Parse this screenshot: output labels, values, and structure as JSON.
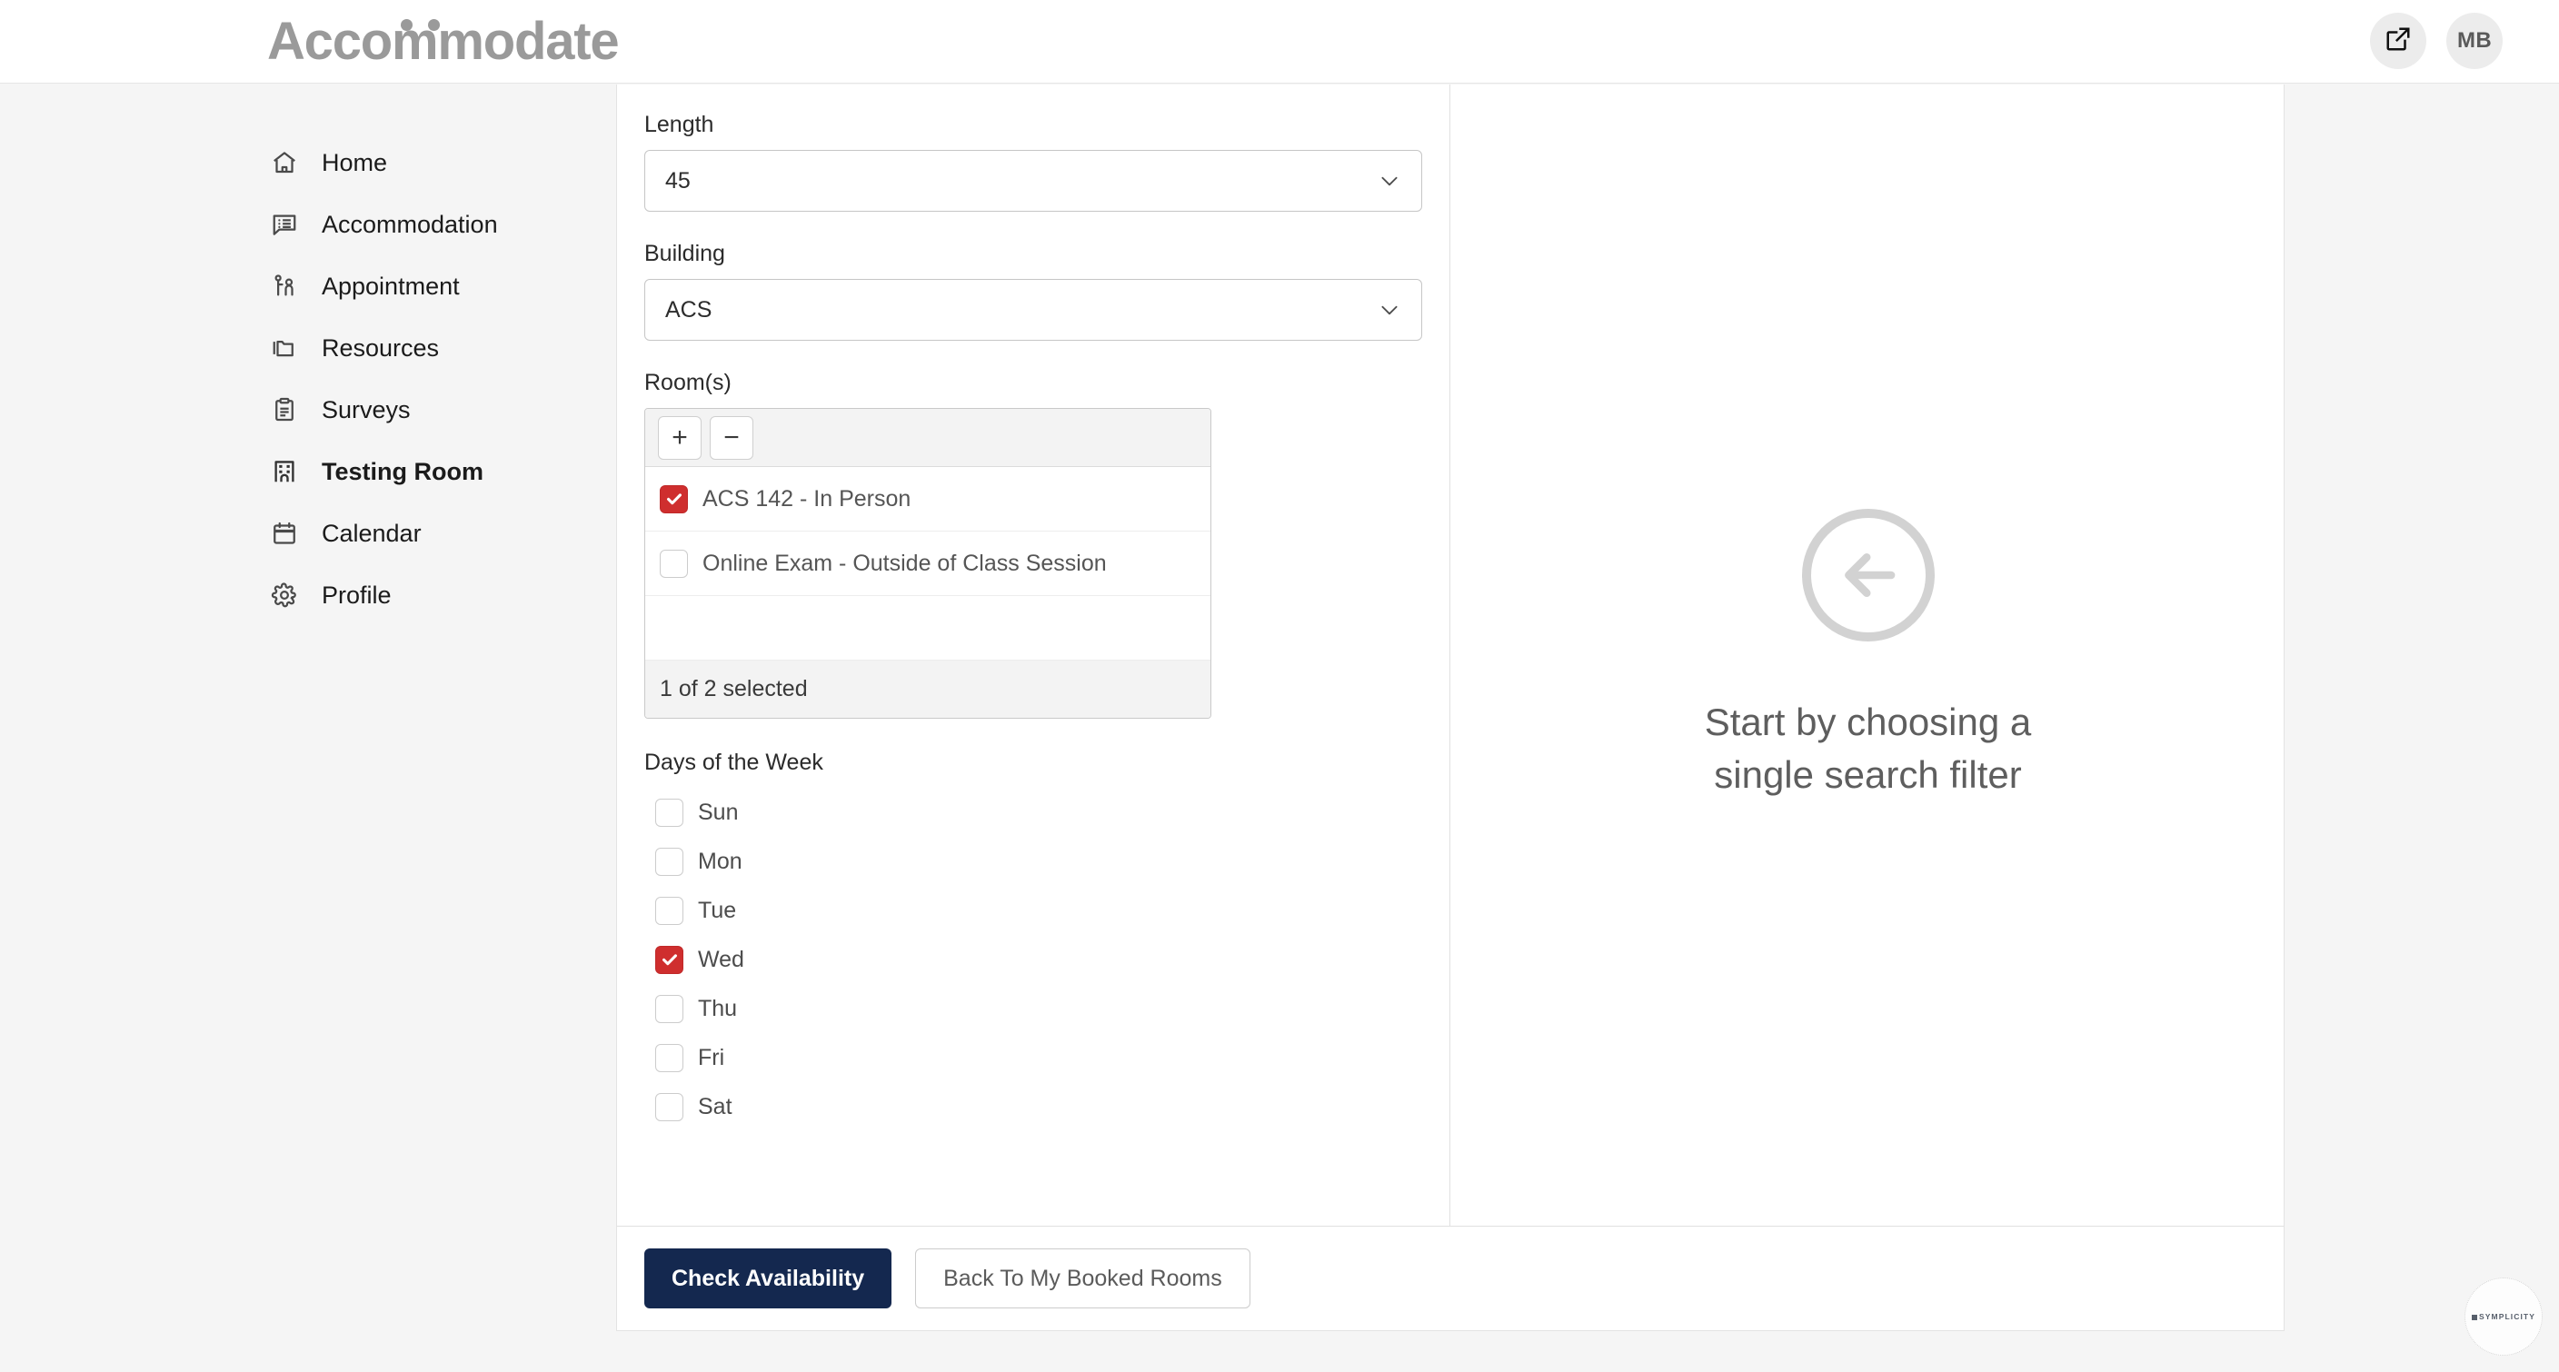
{
  "header": {
    "brand": "Accommodate",
    "brand_part_1": "Acco",
    "brand_part_2": "mm",
    "brand_part_3": "odate",
    "external_link_title": "Open in new window",
    "avatar_initials": "MB"
  },
  "sidebar": {
    "items": [
      {
        "label": "Home",
        "icon": "home-icon",
        "active": false
      },
      {
        "label": "Accommodation",
        "icon": "chat-list-icon",
        "active": false
      },
      {
        "label": "Appointment",
        "icon": "people-icon",
        "active": false
      },
      {
        "label": "Resources",
        "icon": "folders-icon",
        "active": false
      },
      {
        "label": "Surveys",
        "icon": "clipboard-icon",
        "active": false
      },
      {
        "label": "Testing Room",
        "icon": "building-icon",
        "active": true
      },
      {
        "label": "Calendar",
        "icon": "calendar-icon",
        "active": false
      },
      {
        "label": "Profile",
        "icon": "gear-icon",
        "active": false
      }
    ]
  },
  "form": {
    "length": {
      "label": "Length",
      "value": "45"
    },
    "building": {
      "label": "Building",
      "value": "ACS"
    },
    "rooms": {
      "label": "Room(s)",
      "add_button": "+",
      "remove_button": "−",
      "options": [
        {
          "label": "ACS 142 - In Person",
          "checked": true
        },
        {
          "label": "Online Exam - Outside of Class Session",
          "checked": false
        }
      ],
      "selection_summary": "1 of 2 selected"
    },
    "days": {
      "label": "Days of the Week",
      "options": [
        {
          "label": "Sun",
          "checked": false
        },
        {
          "label": "Mon",
          "checked": false
        },
        {
          "label": "Tue",
          "checked": false
        },
        {
          "label": "Wed",
          "checked": true
        },
        {
          "label": "Thu",
          "checked": false
        },
        {
          "label": "Fri",
          "checked": false
        },
        {
          "label": "Sat",
          "checked": false
        }
      ]
    }
  },
  "preview": {
    "icon": "arrow-left-circle-icon",
    "message_line_1": "Start by choosing a",
    "message_line_2": "single search filter"
  },
  "actions": {
    "primary": "Check Availability",
    "secondary": "Back To My Booked Rooms"
  },
  "watermark": {
    "text": "SYMPLICITY"
  },
  "colors": {
    "accent_red": "#cf2e2e",
    "primary_navy": "#14284f",
    "page_background": "#f5f5f5",
    "card_background": "#ffffff",
    "muted_text": "#5e5e5e"
  }
}
